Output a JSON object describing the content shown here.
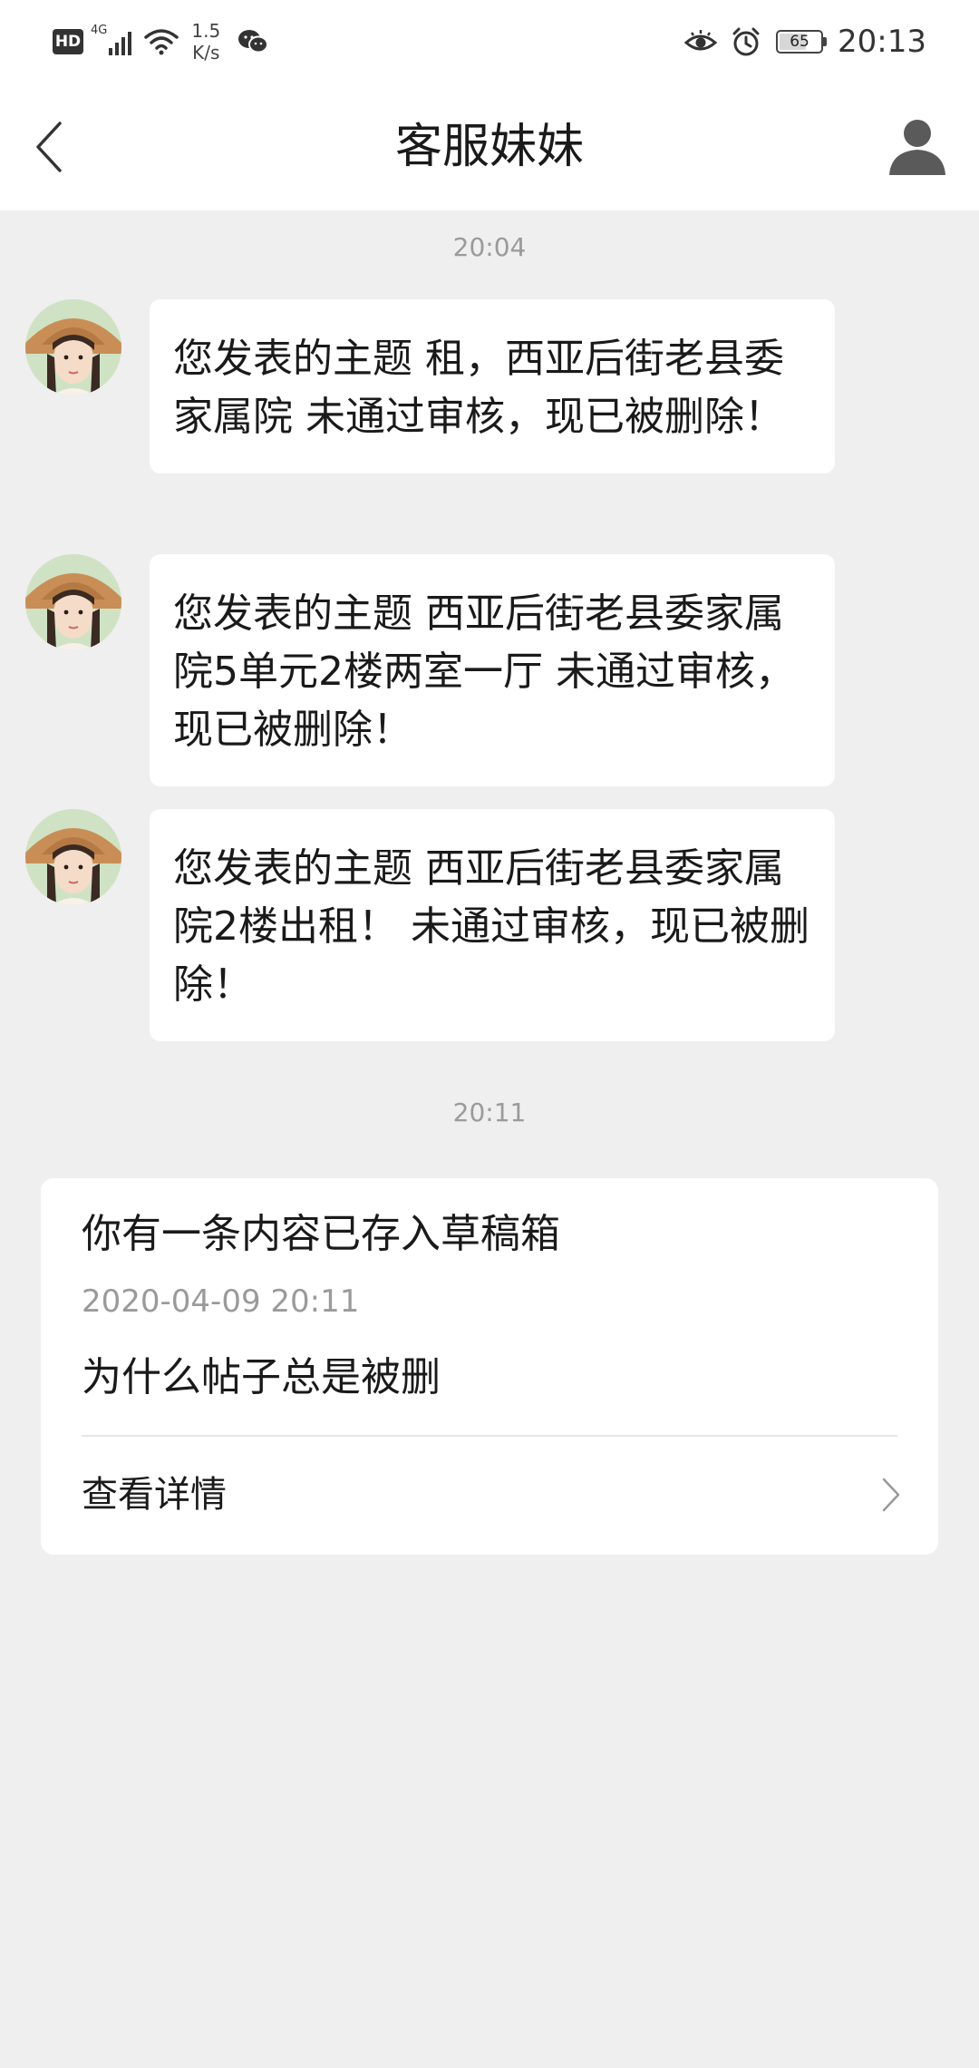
{
  "status_bar": {
    "hd_label": "HD",
    "network_type": "4G",
    "net_speed_value": "1.5",
    "net_speed_unit": "K/s",
    "battery_level": "65",
    "battery_fraction": 0.65,
    "time": "20:13"
  },
  "nav": {
    "title": "客服妹妹",
    "back_icon": "chevron-left-icon",
    "profile_icon": "person-icon"
  },
  "chat": {
    "timestamps": [
      "20:04",
      "20:11"
    ],
    "messages": [
      {
        "text": "您发表的主题 租，西亚后街老县委家属院 未通过审核，现已被删除！"
      },
      {
        "text": "您发表的主题 西亚后街老县委家属院5单元2楼两室一厅 未通过审核，现已被删除！"
      },
      {
        "text": "您发表的主题 西亚后街老县委家属院2楼出租！ 未通过审核，现已被删除！"
      }
    ]
  },
  "draft_card": {
    "title": "你有一条内容已存入草稿箱",
    "datetime": "2020-04-09 20:11",
    "content": "为什么帖子总是被删",
    "action_label": "查看详情"
  },
  "colors": {
    "background": "#efefef",
    "card": "#ffffff",
    "secondary_text": "#9a9a9a",
    "primary_text": "#1a1a1a"
  }
}
